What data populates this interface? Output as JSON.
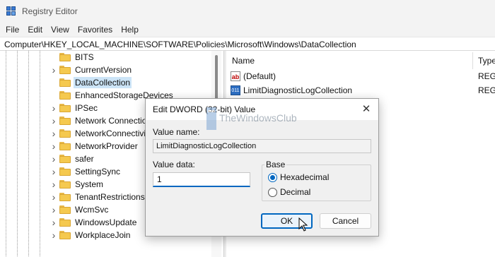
{
  "app": {
    "title": "Registry Editor",
    "accent": "#0067c0"
  },
  "menu": [
    "File",
    "Edit",
    "View",
    "Favorites",
    "Help"
  ],
  "address": "Computer\\HKEY_LOCAL_MACHINE\\SOFTWARE\\Policies\\Microsoft\\Windows\\DataCollection",
  "tree": {
    "items": [
      {
        "label": "BITS",
        "expandable": false,
        "selected": false
      },
      {
        "label": "CurrentVersion",
        "expandable": true,
        "selected": false
      },
      {
        "label": "DataCollection",
        "expandable": false,
        "selected": true
      },
      {
        "label": "EnhancedStorageDevices",
        "expandable": false,
        "selected": false
      },
      {
        "label": "IPSec",
        "expandable": true,
        "selected": false
      },
      {
        "label": "Network Connection",
        "expandable": true,
        "selected": false
      },
      {
        "label": "NetworkConnectivi",
        "expandable": true,
        "selected": false
      },
      {
        "label": "NetworkProvider",
        "expandable": true,
        "selected": false
      },
      {
        "label": "safer",
        "expandable": true,
        "selected": false
      },
      {
        "label": "SettingSync",
        "expandable": true,
        "selected": false
      },
      {
        "label": "System",
        "expandable": true,
        "selected": false
      },
      {
        "label": "TenantRestrictions",
        "expandable": true,
        "selected": false
      },
      {
        "label": "WcmSvc",
        "expandable": true,
        "selected": false
      },
      {
        "label": "WindowsUpdate",
        "expandable": true,
        "selected": false
      },
      {
        "label": "WorkplaceJoin",
        "expandable": true,
        "selected": false
      }
    ]
  },
  "values_pane": {
    "col_name": "Name",
    "col_type": "Type",
    "rows": [
      {
        "icon": "string-value-icon",
        "icon_text": "ab",
        "name": "(Default)",
        "type": "REG_"
      },
      {
        "icon": "binary-value-icon",
        "icon_text": "011",
        "name": "LimitDiagnosticLogCollection",
        "type": "REG_"
      }
    ]
  },
  "dialog": {
    "title": "Edit DWORD (32-bit) Value",
    "value_name_label": "Value name:",
    "value_name": "LimitDiagnosticLogCollection",
    "value_data_label": "Value data:",
    "value_data": "1",
    "base_label": "Base",
    "hex_label": "Hexadecimal",
    "dec_label": "Decimal",
    "base_selected": "Hexadecimal",
    "ok_label": "OK",
    "cancel_label": "Cancel"
  },
  "watermark": {
    "text": "TheWindowsClub"
  }
}
